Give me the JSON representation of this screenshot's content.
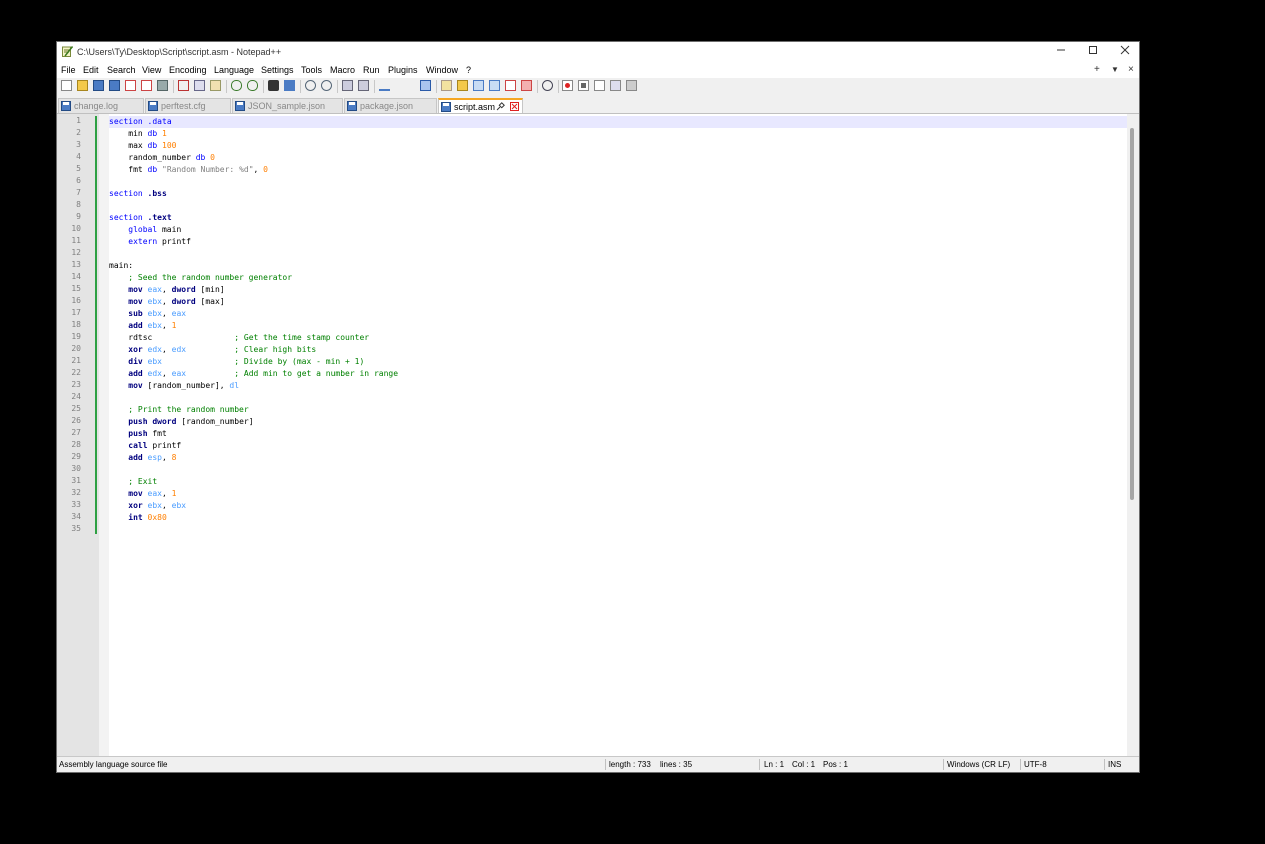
{
  "window": {
    "title": "C:\\Users\\Ty\\Desktop\\Script\\script.asm - Notepad++"
  },
  "menu": [
    {
      "label": "File"
    },
    {
      "label": "Edit"
    },
    {
      "label": "Search"
    },
    {
      "label": "View"
    },
    {
      "label": "Encoding"
    },
    {
      "label": "Language"
    },
    {
      "label": "Settings"
    },
    {
      "label": "Tools"
    },
    {
      "label": "Macro"
    },
    {
      "label": "Run"
    },
    {
      "label": "Plugins"
    },
    {
      "label": "Window"
    },
    {
      "label": "?"
    }
  ],
  "menu_right": {
    "add": "+",
    "dropdown": "▼",
    "close": "×"
  },
  "tabs": [
    {
      "label": "change.log",
      "active": false
    },
    {
      "label": "perftest.cfg",
      "active": false
    },
    {
      "label": "JSON_sample.json",
      "active": false
    },
    {
      "label": "package.json",
      "active": false
    },
    {
      "label": "script.asm",
      "active": true
    }
  ],
  "code": [
    [
      [
        "section",
        "sec"
      ],
      [
        " ",
        "id"
      ],
      [
        ".data",
        "sec"
      ]
    ],
    [
      [
        "    min ",
        "id"
      ],
      [
        "db",
        "dir"
      ],
      [
        " ",
        "id"
      ],
      [
        "1",
        "num"
      ]
    ],
    [
      [
        "    max ",
        "id"
      ],
      [
        "db",
        "dir"
      ],
      [
        " ",
        "id"
      ],
      [
        "100",
        "num"
      ]
    ],
    [
      [
        "    random_number ",
        "id"
      ],
      [
        "db",
        "dir"
      ],
      [
        " ",
        "id"
      ],
      [
        "0",
        "num"
      ]
    ],
    [
      [
        "    fmt ",
        "id"
      ],
      [
        "db",
        "dir"
      ],
      [
        " ",
        "id"
      ],
      [
        "\"Random Number: %d\"",
        "str"
      ],
      [
        ", ",
        "id"
      ],
      [
        "0",
        "num"
      ]
    ],
    [],
    [
      [
        "section",
        "sec"
      ],
      [
        " ",
        "id"
      ],
      [
        ".bss",
        "ins"
      ]
    ],
    [],
    [
      [
        "section",
        "sec"
      ],
      [
        " ",
        "id"
      ],
      [
        ".text",
        "ins"
      ]
    ],
    [
      [
        "    ",
        "id"
      ],
      [
        "global",
        "dir"
      ],
      [
        " main",
        "id"
      ]
    ],
    [
      [
        "    ",
        "id"
      ],
      [
        "extern",
        "dir"
      ],
      [
        " printf",
        "id"
      ]
    ],
    [],
    [
      [
        "main:",
        "id"
      ]
    ],
    [
      [
        "    ",
        "id"
      ],
      [
        "; Seed the random number generator",
        "cmt"
      ]
    ],
    [
      [
        "    ",
        "id"
      ],
      [
        "mov",
        "ins"
      ],
      [
        " ",
        "id"
      ],
      [
        "eax",
        "reg"
      ],
      [
        ", ",
        "id"
      ],
      [
        "dword",
        "ins"
      ],
      [
        " [min]",
        "id"
      ]
    ],
    [
      [
        "    ",
        "id"
      ],
      [
        "mov",
        "ins"
      ],
      [
        " ",
        "id"
      ],
      [
        "ebx",
        "reg"
      ],
      [
        ", ",
        "id"
      ],
      [
        "dword",
        "ins"
      ],
      [
        " [max]",
        "id"
      ]
    ],
    [
      [
        "    ",
        "id"
      ],
      [
        "sub",
        "ins"
      ],
      [
        " ",
        "id"
      ],
      [
        "ebx",
        "reg"
      ],
      [
        ", ",
        "id"
      ],
      [
        "eax",
        "reg"
      ]
    ],
    [
      [
        "    ",
        "id"
      ],
      [
        "add",
        "ins"
      ],
      [
        " ",
        "id"
      ],
      [
        "ebx",
        "reg"
      ],
      [
        ", ",
        "id"
      ],
      [
        "1",
        "num"
      ]
    ],
    [
      [
        "    rdtsc",
        "id"
      ],
      [
        "                 ",
        "id"
      ],
      [
        "; Get the time stamp counter",
        "cmt"
      ]
    ],
    [
      [
        "    ",
        "id"
      ],
      [
        "xor",
        "ins"
      ],
      [
        " ",
        "id"
      ],
      [
        "edx",
        "reg"
      ],
      [
        ", ",
        "id"
      ],
      [
        "edx",
        "reg"
      ],
      [
        "          ",
        "id"
      ],
      [
        "; Clear high bits",
        "cmt"
      ]
    ],
    [
      [
        "    ",
        "id"
      ],
      [
        "div",
        "ins"
      ],
      [
        " ",
        "id"
      ],
      [
        "ebx",
        "reg"
      ],
      [
        "               ",
        "id"
      ],
      [
        "; Divide by (max - min + 1)",
        "cmt"
      ]
    ],
    [
      [
        "    ",
        "id"
      ],
      [
        "add",
        "ins"
      ],
      [
        " ",
        "id"
      ],
      [
        "edx",
        "reg"
      ],
      [
        ", ",
        "id"
      ],
      [
        "eax",
        "reg"
      ],
      [
        "          ",
        "id"
      ],
      [
        "; Add min to get a number in range",
        "cmt"
      ]
    ],
    [
      [
        "    ",
        "id"
      ],
      [
        "mov",
        "ins"
      ],
      [
        " [random_number], ",
        "id"
      ],
      [
        "dl",
        "reg"
      ]
    ],
    [],
    [
      [
        "    ",
        "id"
      ],
      [
        "; Print the random number",
        "cmt"
      ]
    ],
    [
      [
        "    ",
        "id"
      ],
      [
        "push",
        "ins"
      ],
      [
        " ",
        "id"
      ],
      [
        "dword",
        "ins"
      ],
      [
        " [random_number]",
        "id"
      ]
    ],
    [
      [
        "    ",
        "id"
      ],
      [
        "push",
        "ins"
      ],
      [
        " fmt",
        "id"
      ]
    ],
    [
      [
        "    ",
        "id"
      ],
      [
        "call",
        "ins"
      ],
      [
        " printf",
        "id"
      ]
    ],
    [
      [
        "    ",
        "id"
      ],
      [
        "add",
        "ins"
      ],
      [
        " ",
        "id"
      ],
      [
        "esp",
        "reg"
      ],
      [
        ", ",
        "id"
      ],
      [
        "8",
        "num"
      ]
    ],
    [],
    [
      [
        "    ",
        "id"
      ],
      [
        "; Exit",
        "cmt"
      ]
    ],
    [
      [
        "    ",
        "id"
      ],
      [
        "mov",
        "ins"
      ],
      [
        " ",
        "id"
      ],
      [
        "eax",
        "reg"
      ],
      [
        ", ",
        "id"
      ],
      [
        "1",
        "num"
      ]
    ],
    [
      [
        "    ",
        "id"
      ],
      [
        "xor",
        "ins"
      ],
      [
        " ",
        "id"
      ],
      [
        "ebx",
        "reg"
      ],
      [
        ", ",
        "id"
      ],
      [
        "ebx",
        "reg"
      ]
    ],
    [
      [
        "    ",
        "id"
      ],
      [
        "int",
        "ins"
      ],
      [
        " ",
        "id"
      ],
      [
        "0x80",
        "num"
      ]
    ],
    []
  ],
  "status": {
    "file_type": "Assembly language source file",
    "length": "length : 733",
    "lines": "lines : 35",
    "ln": "Ln : 1",
    "col": "Col : 1",
    "pos": "Pos : 1",
    "eol": "Windows (CR LF)",
    "encoding": "UTF-8",
    "mode": "INS"
  },
  "colors": {
    "section_keyword": "#0000ff",
    "instruction": "#00007f",
    "register": "#4a9cff",
    "number": "#ff7f00",
    "string": "#808080",
    "comment": "#008000",
    "active_tab_accent": "#f5a623",
    "change_bar": "#2ea043"
  }
}
